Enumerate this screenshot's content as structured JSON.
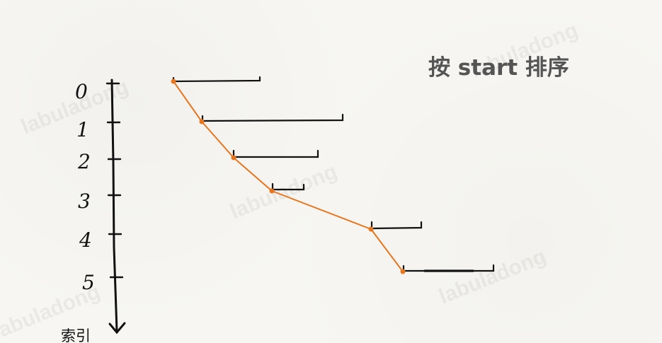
{
  "title": "按 start 排序",
  "axis": {
    "label": "索引",
    "ticks": [
      "0",
      "1",
      "2",
      "3",
      "4",
      "5"
    ]
  },
  "watermark": "labuladong",
  "colors": {
    "path": "#e8761e",
    "ink": "#111111",
    "title": "#555555"
  }
}
